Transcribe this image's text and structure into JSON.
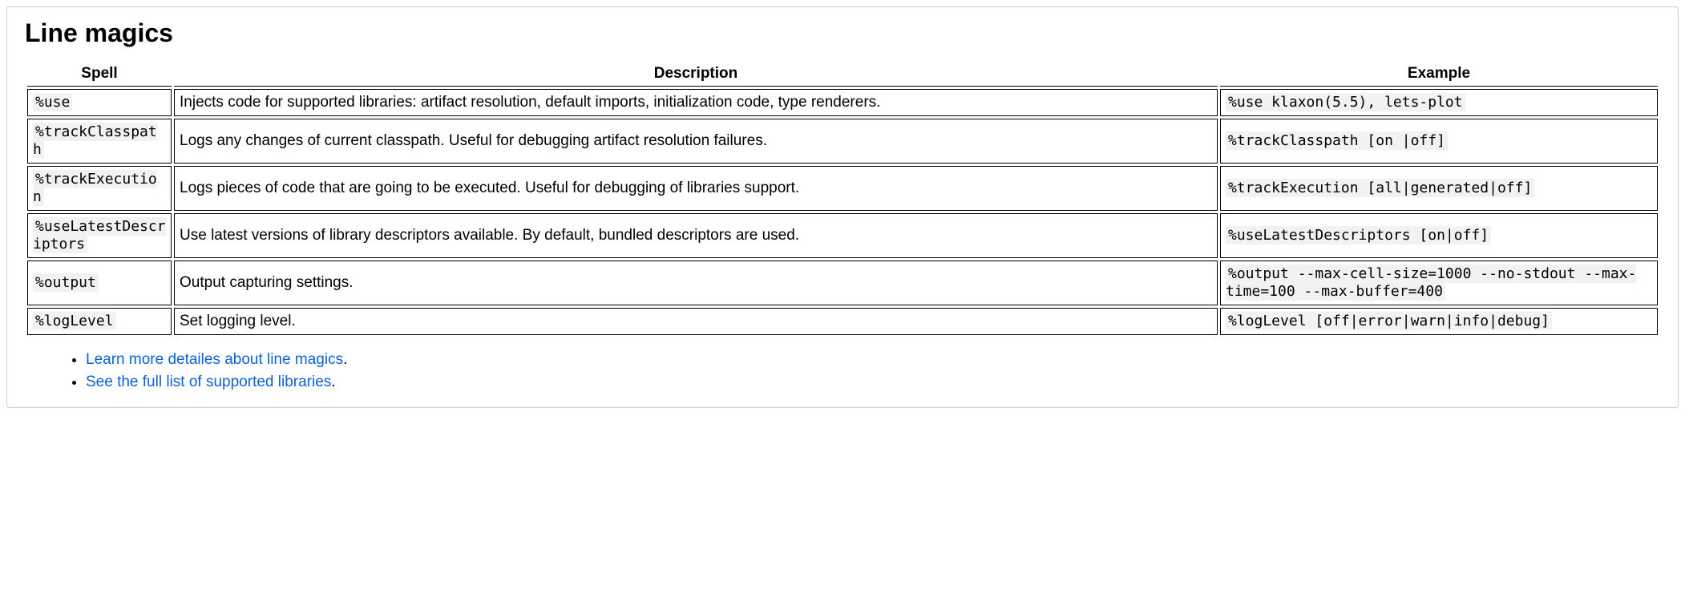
{
  "title": "Line magics",
  "columns": {
    "spell": "Spell",
    "description": "Description",
    "example": "Example"
  },
  "rows": [
    {
      "spell": "%use",
      "description": "Injects code for supported libraries: artifact resolution, default imports, initialization code, type renderers.",
      "example": "%use klaxon(5.5), lets-plot"
    },
    {
      "spell": "%trackClasspath",
      "description": "Logs any changes of current classpath. Useful for debugging artifact resolution failures.",
      "example": "%trackClasspath [on |off]"
    },
    {
      "spell": "%trackExecution",
      "description": "Logs pieces of code that are going to be executed. Useful for debugging of libraries support.",
      "example": "%trackExecution [all|generated|off]"
    },
    {
      "spell": "%useLatestDescriptors",
      "description": "Use latest versions of library descriptors available. By default, bundled descriptors are used.",
      "example": "%useLatestDescriptors [on|off]"
    },
    {
      "spell": "%output",
      "description": "Output capturing settings.",
      "example": "%output --max-cell-size=1000 --no-stdout --max-time=100 --max-buffer=400"
    },
    {
      "spell": "%logLevel",
      "description": "Set logging level.",
      "example": "%logLevel [off|error|warn|info|debug]"
    }
  ],
  "links": [
    {
      "text": "Learn more detailes about line magics",
      "suffix": "."
    },
    {
      "text": "See the full list of supported libraries",
      "suffix": "."
    }
  ]
}
